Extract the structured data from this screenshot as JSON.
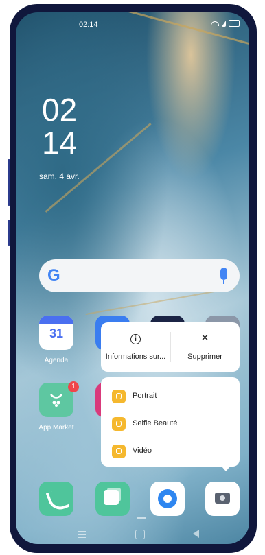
{
  "status_bar": {
    "time": "02:14"
  },
  "lockscreen": {
    "clock_hours": "02",
    "clock_minutes": "14",
    "date": "sam. 4 avr."
  },
  "search_bar": {
    "logo": "G"
  },
  "apps": {
    "agenda": {
      "label": "Agenda",
      "day": "31"
    },
    "app_market": {
      "label": "App Market",
      "badge_count": "1"
    }
  },
  "context_menu": {
    "top_actions": [
      {
        "icon": "info-icon",
        "label": "Informations sur..."
      },
      {
        "icon": "close-icon",
        "label": "Supprimer"
      }
    ],
    "shortcuts": [
      {
        "icon": "portrait-icon",
        "label": "Portrait"
      },
      {
        "icon": "selfie-beauty-icon",
        "label": "Selfie Beauté"
      },
      {
        "icon": "video-icon",
        "label": "Vidéo"
      }
    ]
  },
  "dock": [
    {
      "icon": "phone-icon"
    },
    {
      "icon": "messages-icon"
    },
    {
      "icon": "browser-icon"
    },
    {
      "icon": "camera-icon"
    }
  ],
  "colors": {
    "accent": "#f5b82e",
    "badge": "#f0454b",
    "google_blue": "#4285f4"
  }
}
